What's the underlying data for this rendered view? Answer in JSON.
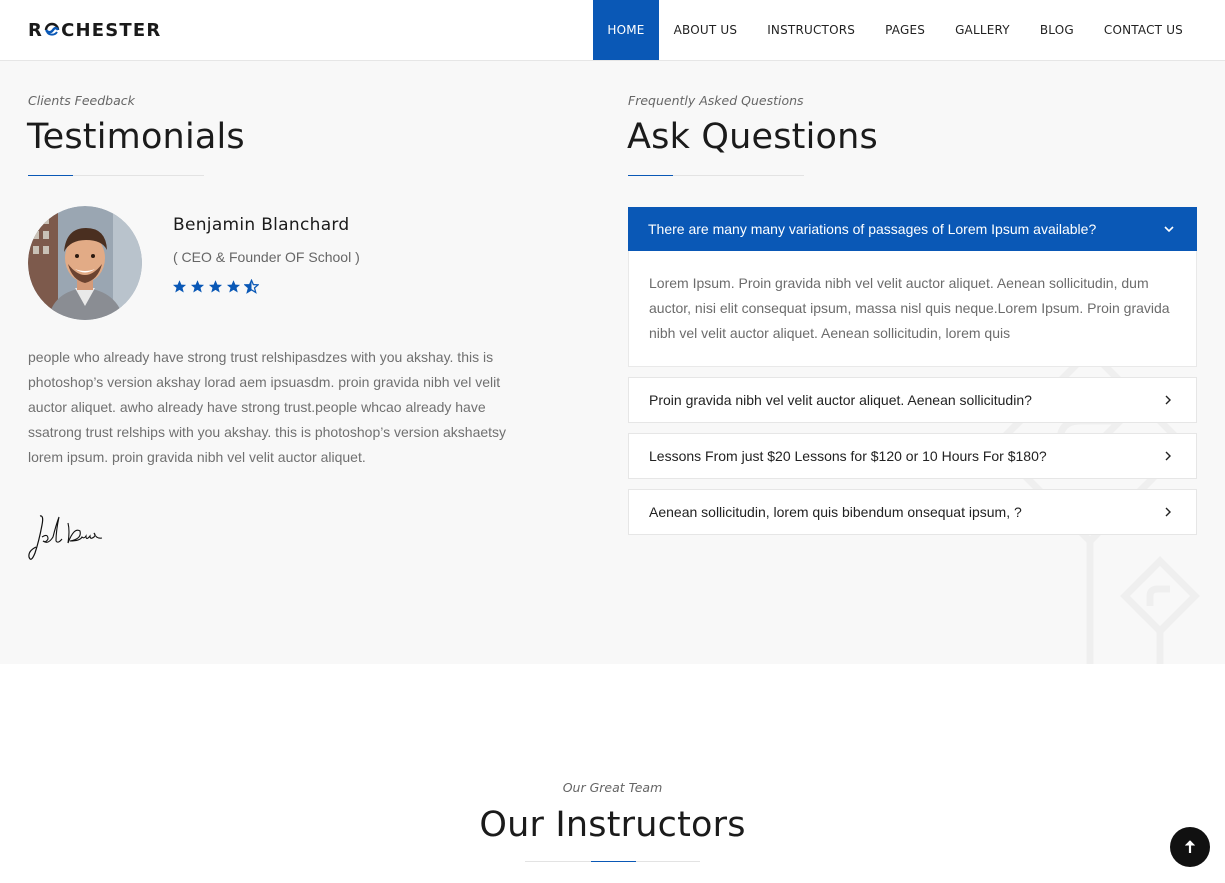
{
  "brand": {
    "name_first": "R",
    "name_rest": "CHESTER",
    "logo_icon": "swirl-o-icon",
    "accent_color": "#0a58b6"
  },
  "nav": {
    "items": [
      {
        "label": "HOME",
        "active": true
      },
      {
        "label": "ABOUT US"
      },
      {
        "label": "INSTRUCTORS"
      },
      {
        "label": "PAGES"
      },
      {
        "label": "GALLERY"
      },
      {
        "label": "BLOG"
      },
      {
        "label": "CONTACT US"
      }
    ]
  },
  "testimonials": {
    "eyebrow": "Clients Feedback",
    "title": "Testimonials",
    "person": {
      "name": "Benjamin Blanchard",
      "role": "( CEO & Founder OF School )",
      "rating": 4.5,
      "rating_max": 5
    },
    "quote": "people who already have strong trust relshipasdzes with you akshay. this is photoshop’s version akshay lorad aem ipsuasdm. proin gravida nibh vel velit auctor aliquet. awho already have strong trust.people whcao already have ssatrong trust relships with you akshay. this is photoshop’s version akshaetsy lorem ipsum. proin gravida nibh vel velit auctor aliquet."
  },
  "faq": {
    "eyebrow": "Frequently Asked Questions",
    "title": "Ask Questions",
    "open_item": {
      "question": "There are many many variations of passages of Lorem Ipsum available?",
      "answer": "Lorem Ipsum. Proin gravida nibh vel velit auctor aliquet. Aenean sollicitudin, dum auctor, nisi elit consequat ipsum, massa nisl quis neque.Lorem Ipsum. Proin gravida nibh vel velit auctor aliquet. Aenean sollicitudin, lorem quis"
    },
    "items": [
      {
        "question": "Proin gravida nibh vel velit auctor aliquet. Aenean sollicitudin?"
      },
      {
        "question": "Lessons From just $20 Lessons for $120 or 10 Hours For $180?"
      },
      {
        "question": "Aenean sollicitudin, lorem quis bibendum onsequat ipsum, ?"
      }
    ]
  },
  "instructors": {
    "eyebrow": "Our Great Team",
    "title": "Our Instructors"
  },
  "scroll_top": {
    "icon": "arrow-up-icon"
  }
}
